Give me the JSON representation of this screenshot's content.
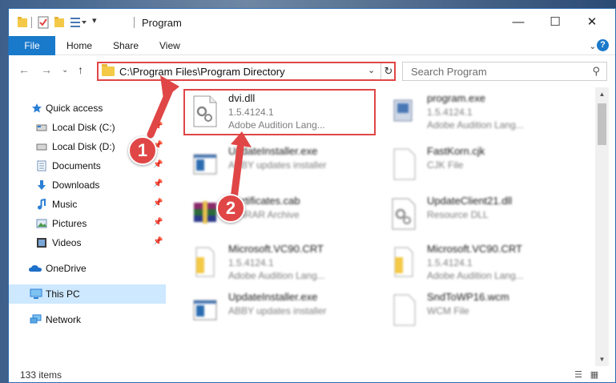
{
  "window": {
    "title": "Program"
  },
  "ribbon": {
    "tabs": [
      "File",
      "Home",
      "Share",
      "View"
    ],
    "help_label": "?"
  },
  "nav": {
    "back_icon": "arrow-left-icon",
    "forward_icon": "arrow-right-icon",
    "recent_icon": "chevron-down-icon",
    "up_icon": "arrow-up-icon",
    "address_path": "C:\\Program Files\\Program Directory",
    "search_placeholder": "Search Program"
  },
  "sidebar": {
    "items": [
      {
        "label": "Quick access",
        "icon": "star-icon"
      },
      {
        "label": "Local Disk (C:)",
        "icon": "drive-icon"
      },
      {
        "label": "Local Disk (D:)",
        "icon": "drive-icon"
      },
      {
        "label": "Documents",
        "icon": "documents-icon"
      },
      {
        "label": "Downloads",
        "icon": "download-icon"
      },
      {
        "label": "Music",
        "icon": "music-icon"
      },
      {
        "label": "Pictures",
        "icon": "pictures-icon"
      },
      {
        "label": "Videos",
        "icon": "videos-icon"
      },
      {
        "label": "OneDrive",
        "icon": "cloud-icon"
      },
      {
        "label": "This PC",
        "icon": "computer-icon"
      },
      {
        "label": "Network",
        "icon": "network-icon"
      }
    ]
  },
  "files": [
    {
      "name": "dvi.dll",
      "line1": "1.5.4124.1",
      "line2": "Adobe Audition Lang...",
      "icon": "dll-gear-icon"
    },
    {
      "name": "program.exe",
      "line1": "1.5.4124.1",
      "line2": "Adobe Audition Lang...",
      "icon": "exe-icon"
    },
    {
      "name": "UpdateInstaller.exe",
      "line1": "ABBY updates installer",
      "line2": "",
      "icon": "exe-window-icon"
    },
    {
      "name": "FastKorn.cjk",
      "line1": "CJK File",
      "line2": "",
      "icon": "blank-file-icon"
    },
    {
      "name": "Certificates.cab",
      "line1": "WinRAR Archive",
      "line2": "",
      "icon": "archive-icon"
    },
    {
      "name": "UpdateClient21.dll",
      "line1": "Resource DLL",
      "line2": "",
      "icon": "dll-gear-icon"
    },
    {
      "name": "Microsoft.VC90.CRT",
      "line1": "1.5.4124.1",
      "line2": "Adobe Audition Lang...",
      "icon": "folder-file-icon"
    },
    {
      "name": "Microsoft.VC90.CRT",
      "line1": "1.5.4124.1",
      "line2": "Adobe Audition Lang...",
      "icon": "folder-file-icon"
    },
    {
      "name": "UpdateInstaller.exe",
      "line1": "ABBY updates installer",
      "line2": "",
      "icon": "exe-window-icon"
    },
    {
      "name": "SndToWP16.wcm",
      "line1": "WCM File",
      "line2": "",
      "icon": "blank-file-icon"
    }
  ],
  "status": {
    "item_count": "133 items"
  },
  "callouts": {
    "one": "1",
    "two": "2"
  },
  "colors": {
    "accent": "#1979ca",
    "highlight": "#e04646",
    "selected": "#cde8ff"
  }
}
